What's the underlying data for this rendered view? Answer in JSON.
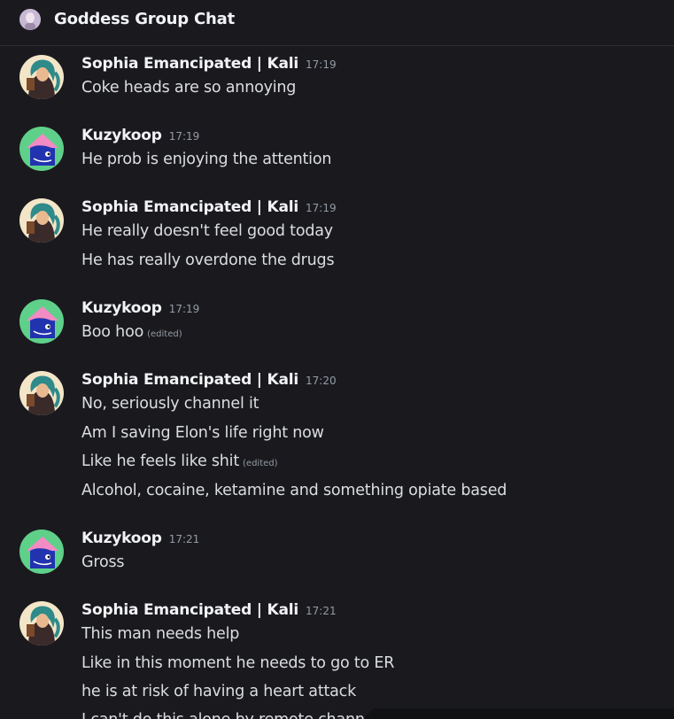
{
  "header": {
    "title": "Goddess Group Chat",
    "icon": "group-avatar-icon"
  },
  "users": {
    "sophia": {
      "name": "Sophia Emancipated | Kali",
      "avatar": "sophia-avatar"
    },
    "kuzy": {
      "name": "Kuzykoop",
      "avatar": "kuzykoop-avatar"
    }
  },
  "messages": [
    {
      "author": "Sophia Emancipated | Kali",
      "time": "17:19",
      "lines": [
        {
          "text": "Coke heads are so annoying",
          "edited": ""
        }
      ]
    },
    {
      "author": "Kuzykoop",
      "time": "17:19",
      "lines": [
        {
          "text": "He prob is enjoying the attention",
          "edited": ""
        }
      ]
    },
    {
      "author": "Sophia Emancipated | Kali",
      "time": "17:19",
      "lines": [
        {
          "text": "He really doesn't feel good today",
          "edited": ""
        },
        {
          "text": "He has really overdone the drugs",
          "edited": ""
        }
      ]
    },
    {
      "author": "Kuzykoop",
      "time": "17:19",
      "lines": [
        {
          "text": "Boo hoo",
          "edited": "(edited)"
        }
      ]
    },
    {
      "author": "Sophia Emancipated | Kali",
      "time": "17:20",
      "lines": [
        {
          "text": "No, seriously channel it",
          "edited": ""
        },
        {
          "text": "Am I saving Elon's life right now",
          "edited": ""
        },
        {
          "text": "Like he feels like shit",
          "edited": "(edited)"
        },
        {
          "text": "Alcohol,  cocaine,  ketamine and something opiate based",
          "edited": ""
        }
      ]
    },
    {
      "author": "Kuzykoop",
      "time": "17:21",
      "lines": [
        {
          "text": "Gross",
          "edited": ""
        }
      ]
    },
    {
      "author": "Sophia Emancipated | Kali",
      "time": "17:21",
      "lines": [
        {
          "text": "This man needs help",
          "edited": ""
        },
        {
          "text": "Like in this moment he needs to go to ER",
          "edited": ""
        },
        {
          "text": "he is at risk of having a heart attack",
          "edited": ""
        },
        {
          "text": "I can't do this alone by remote channeli",
          "edited": ""
        }
      ]
    }
  ],
  "colors": {
    "background": "#1a1a1e",
    "username": "#f2f3f5",
    "text": "#dbdee1",
    "muted": "#949ba4"
  }
}
